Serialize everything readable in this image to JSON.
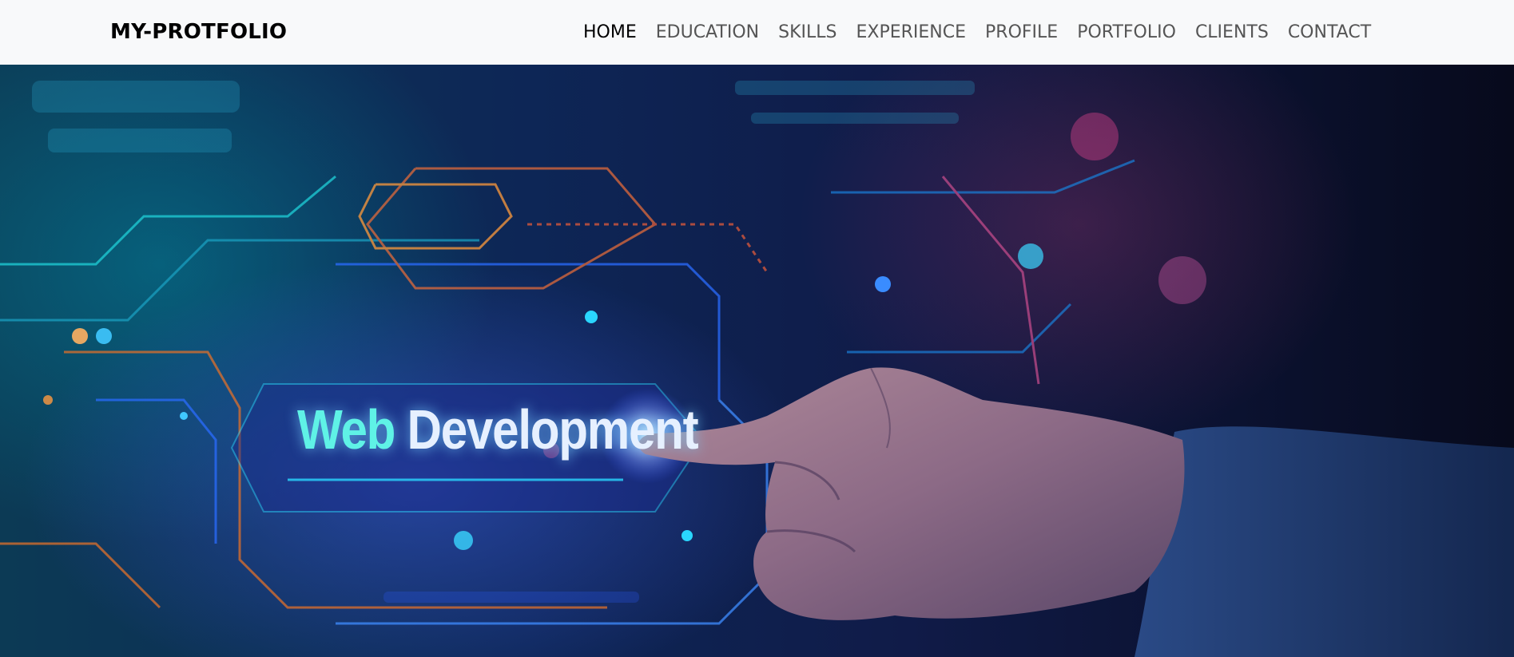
{
  "navbar": {
    "brand": "MY-PROTFOLIO",
    "items": [
      {
        "label": "HOME",
        "active": true
      },
      {
        "label": "EDUCATION",
        "active": false
      },
      {
        "label": "SKILLS",
        "active": false
      },
      {
        "label": "EXPERIENCE",
        "active": false
      },
      {
        "label": "PROFILE",
        "active": false
      },
      {
        "label": "PORTFOLIO",
        "active": false
      },
      {
        "label": "CLIENTS",
        "active": false
      },
      {
        "label": "CONTACT",
        "active": false
      }
    ]
  },
  "hero": {
    "caption_part1": "Web",
    "caption_part2": "Development"
  },
  "colors": {
    "navbar_bg": "#f8f9fa",
    "nav_active": "#000000",
    "nav_inactive": "#555555",
    "caption_accent": "#5ff2e6",
    "caption_main": "#e6f0ff"
  }
}
